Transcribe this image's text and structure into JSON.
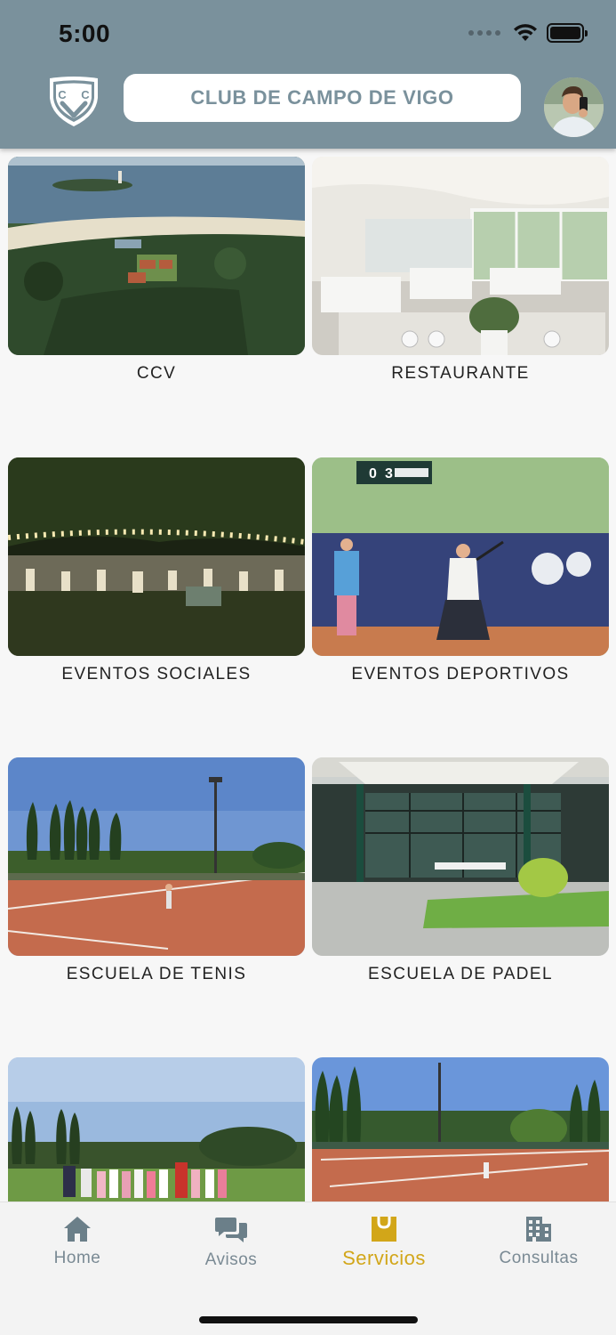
{
  "status_bar": {
    "time": "5:00"
  },
  "header": {
    "title": "CLUB DE CAMPO DE VIGO",
    "logo_letters": "CCC"
  },
  "cards": [
    {
      "label": "CCV",
      "image": "aerial-coast-photo"
    },
    {
      "label": "RESTAURANTE",
      "image": "restaurant-interior-photo"
    },
    {
      "label": "EVENTOS SOCIALES",
      "image": "night-event-photo"
    },
    {
      "label": "EVENTOS DEPORTIVOS",
      "image": "tennis-tournament-photo"
    },
    {
      "label": "ESCUELA DE TENIS",
      "image": "clay-court-photo"
    },
    {
      "label": "ESCUELA DE PADEL",
      "image": "padel-court-photo"
    },
    {
      "label": "",
      "image": "kids-group-photo"
    },
    {
      "label": "",
      "image": "tennis-courts-photo"
    }
  ],
  "scoreboard": {
    "left": "0",
    "right": "3"
  },
  "nav": {
    "items": [
      {
        "label": "Home",
        "icon": "home-icon"
      },
      {
        "label": "Avisos",
        "icon": "chat-icon"
      },
      {
        "label": "Servicios",
        "icon": "shopping-bag-icon",
        "active": true
      },
      {
        "label": "Consultas",
        "icon": "building-icon"
      }
    ]
  },
  "colors": {
    "header": "#7a919c",
    "active_tab": "#d2a619",
    "inactive_tab": "#7a8a94"
  }
}
